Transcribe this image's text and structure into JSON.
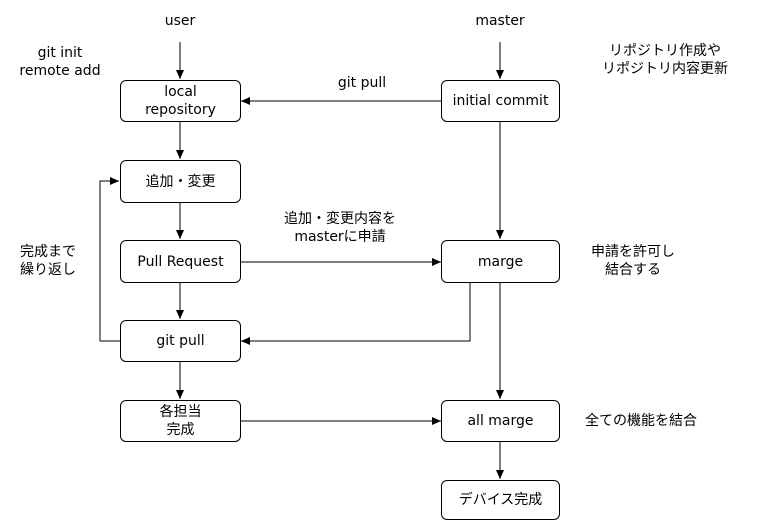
{
  "lanes": {
    "user": "user",
    "master": "master"
  },
  "nodes": {
    "local_repo": [
      "local",
      "repository"
    ],
    "add_change": [
      "追加・変更"
    ],
    "pull_request": [
      "Pull Request"
    ],
    "git_pull_user": [
      "git pull"
    ],
    "each_done": [
      "各担当",
      "完成"
    ],
    "initial_commit": [
      "initial commit"
    ],
    "marge": [
      "marge"
    ],
    "all_marge": [
      "all marge"
    ],
    "device_done": [
      "デバイス完成"
    ]
  },
  "annotations": {
    "git_init": [
      "git init",
      "remote add"
    ],
    "repo_create": [
      "リポジトリ作成や",
      "リポジトリ内容更新"
    ],
    "git_pull_edge": [
      "git pull"
    ],
    "pr_edge": [
      "追加・変更内容を",
      "masterに申請"
    ],
    "repeat": [
      "完成まで",
      "繰り返し"
    ],
    "approve": [
      "申請を許可し",
      "結合する"
    ],
    "combine_all": [
      "全ての機能を結合"
    ]
  }
}
